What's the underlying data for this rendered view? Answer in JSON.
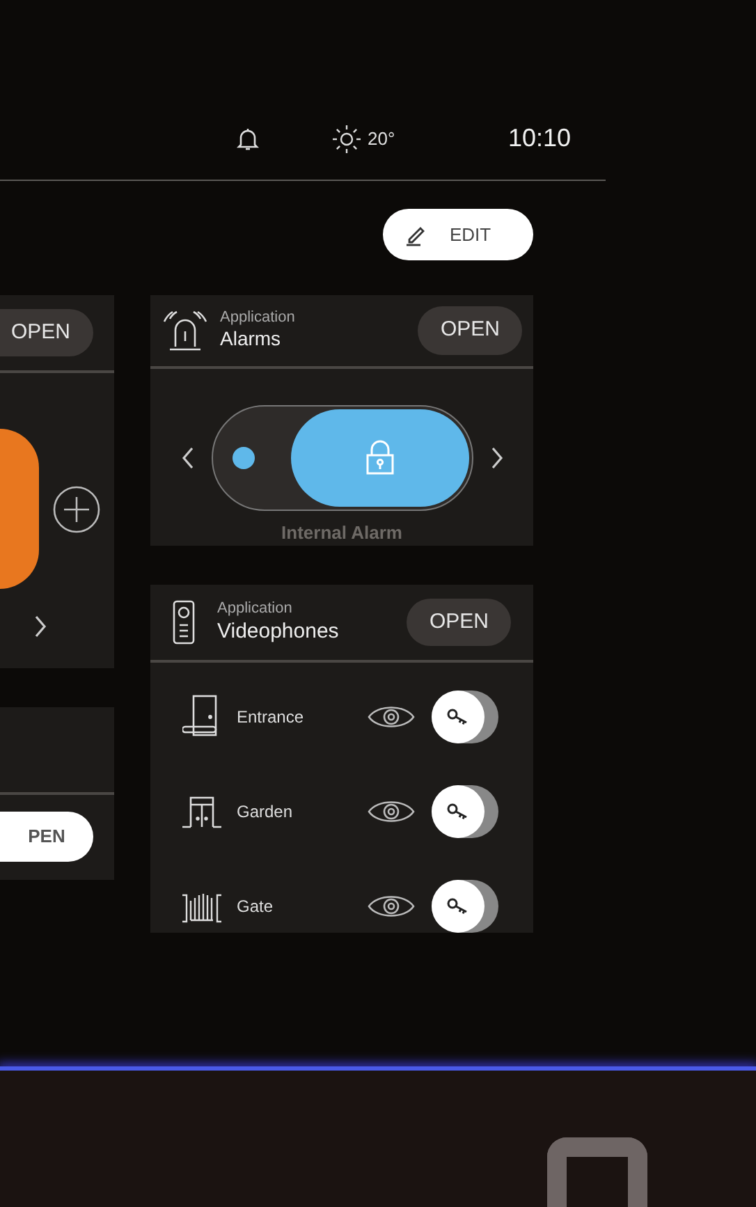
{
  "status_bar": {
    "temperature": "20°",
    "time": "10:10"
  },
  "edit_button": {
    "label": "EDIT"
  },
  "left_cards": [
    {
      "open_label": "OPEN"
    },
    {
      "open_label": "PEN"
    }
  ],
  "alarms": {
    "caption": "Application",
    "title": "Alarms",
    "open_label": "OPEN",
    "switch_on": true,
    "switch_label": "Internal Alarm"
  },
  "videophones": {
    "caption": "Application",
    "title": "Videophones",
    "open_label": "OPEN",
    "rows": [
      {
        "kind": "door",
        "name": "Entrance"
      },
      {
        "kind": "garden",
        "name": "Garden"
      },
      {
        "kind": "gate",
        "name": "Gate"
      }
    ]
  }
}
